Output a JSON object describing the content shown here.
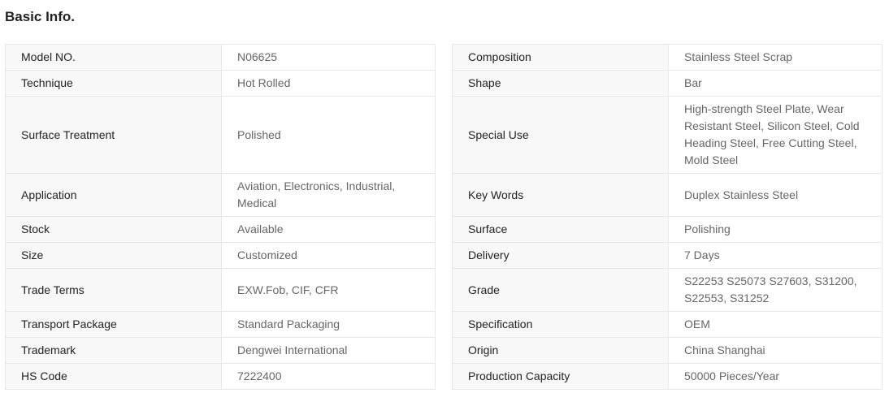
{
  "section": {
    "title": "Basic Info."
  },
  "left_rows": [
    {
      "label": "Model NO.",
      "value": "N06625"
    },
    {
      "label": "Technique",
      "value": "Hot Rolled"
    },
    {
      "label": "Surface Treatment",
      "value": "Polished"
    },
    {
      "label": "Application",
      "value": "Aviation, Electronics, Industrial, Medical"
    },
    {
      "label": "Stock",
      "value": "Available"
    },
    {
      "label": "Size",
      "value": "Customized"
    },
    {
      "label": "Trade Terms",
      "value": "EXW.Fob, CIF, CFR"
    },
    {
      "label": "Transport Package",
      "value": "Standard Packaging"
    },
    {
      "label": "Trademark",
      "value": "Dengwei International"
    },
    {
      "label": "HS Code",
      "value": "7222400"
    }
  ],
  "right_rows": [
    {
      "label": "Composition",
      "value": "Stainless Steel Scrap"
    },
    {
      "label": "Shape",
      "value": "Bar"
    },
    {
      "label": "Special Use",
      "value": "High-strength Steel Plate, Wear Resistant Steel, Silicon Steel, Cold Heading Steel, Free Cutting Steel, Mold Steel"
    },
    {
      "label": "Key Words",
      "value": "Duplex Stainless Steel"
    },
    {
      "label": "Surface",
      "value": "Polishing"
    },
    {
      "label": "Delivery",
      "value": "7 Days"
    },
    {
      "label": "Grade",
      "value": "S22253 S25073 S27603, S31200, S22553, S31252"
    },
    {
      "label": "Specification",
      "value": "OEM"
    },
    {
      "label": "Origin",
      "value": "China Shanghai"
    },
    {
      "label": "Production Capacity",
      "value": "50000 Pieces/Year"
    }
  ]
}
